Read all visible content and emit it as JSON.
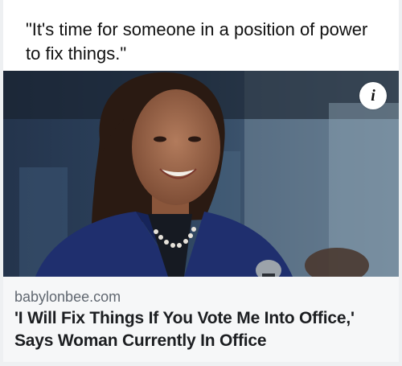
{
  "post": {
    "quote_text": "\"It's time for someone in a position of power to fix things.\""
  },
  "link_preview": {
    "image_alt": "woman-smiling-at-microphone",
    "info_icon_glyph": "i",
    "info_icon": "info-icon",
    "source_domain": "babylonbee.com",
    "headline": "'I Will Fix Things If You Vote Me Into Office,' Says Woman Currently In Office"
  },
  "colors": {
    "page_bg": "#eef0f2",
    "card_bg": "#ffffff",
    "preview_bg": "#f6f7f8",
    "source_text": "#606770",
    "headline_text": "#1c1e21",
    "jacket": "#1f2f6e"
  }
}
